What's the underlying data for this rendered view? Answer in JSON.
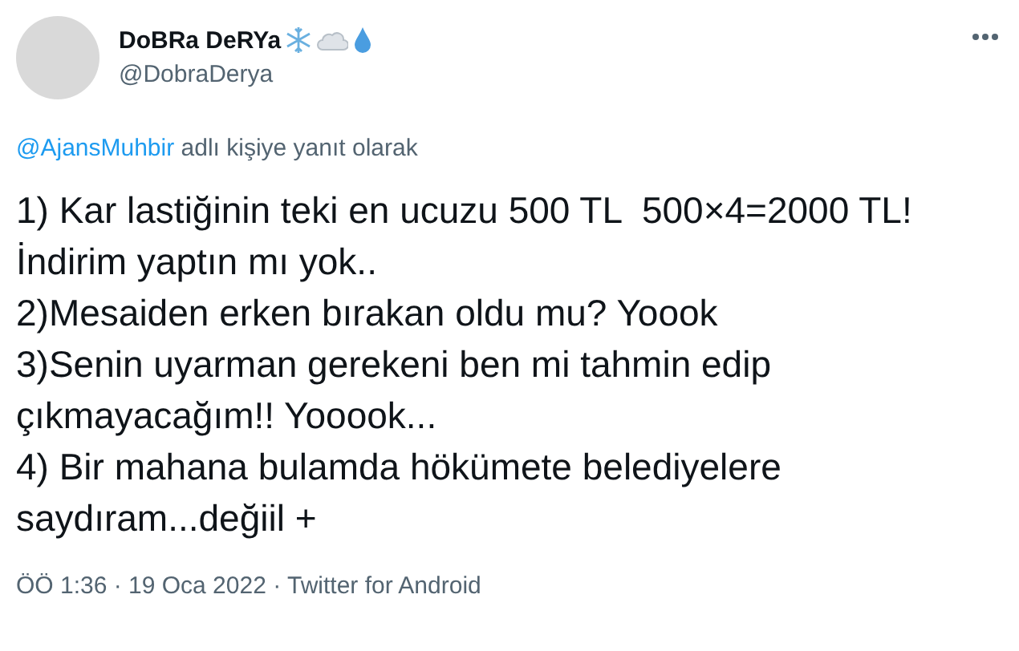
{
  "author": {
    "name": "DoBRa DeRYa",
    "handle": "@DobraDerya"
  },
  "reply_to": {
    "mention": "@AjansMuhbir",
    "text": "adlı kişiye yanıt olarak"
  },
  "tweet_text": "1) Kar lastiğinin teki en ucuzu 500 TL  500×4=2000 TL!\nİndirim yaptın mı yok..\n2)Mesaiden erken bırakan oldu mu? Yoook\n3)Senin uyarman gerekeni ben mi tahmin edip çıkmayacağım!! Yooook...\n4) Bir mahana bulamda hökümete belediyelere saydıram...değiil +",
  "footer": "ÖÖ 1:36 · 19 Oca 2022 · Twitter for Android"
}
